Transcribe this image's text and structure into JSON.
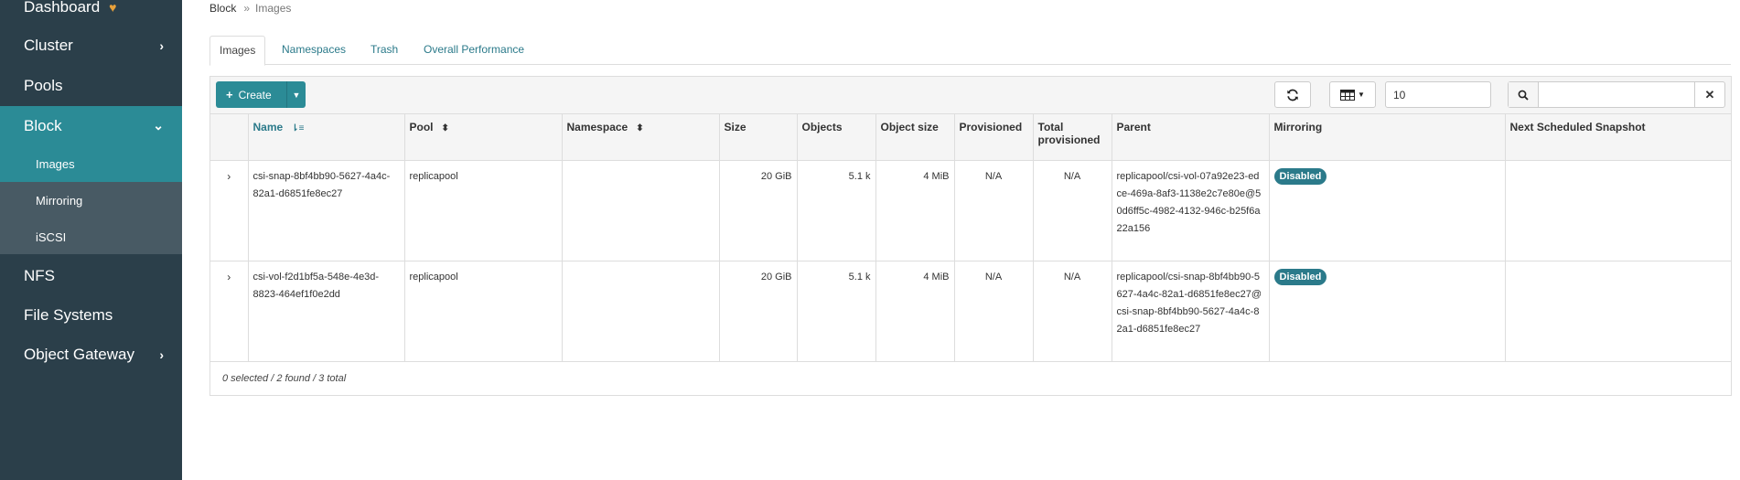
{
  "sidebar": {
    "dashboard": "Dashboard",
    "cluster": "Cluster",
    "pools": "Pools",
    "block": "Block",
    "block_sub": [
      "Images",
      "Mirroring",
      "iSCSI"
    ],
    "nfs": "NFS",
    "file_systems": "File Systems",
    "object_gateway": "Object Gateway"
  },
  "breadcrumb": {
    "parent": "Block",
    "separator": "»",
    "current": "Images"
  },
  "tabs": [
    "Images",
    "Namespaces",
    "Trash",
    "Overall Performance"
  ],
  "toolbar": {
    "create_label": "Create",
    "page_size": "10",
    "search_placeholder": ""
  },
  "table": {
    "columns": [
      "",
      "Name",
      "Pool",
      "Namespace",
      "Size",
      "Objects",
      "Object size",
      "Provisioned",
      "Total provisioned",
      "Parent",
      "Mirroring",
      "Next Scheduled Snapshot"
    ],
    "rows": [
      {
        "name": "csi-snap-8bf4bb90-5627-4a4c-82a1-d6851fe8ec27",
        "pool": "replicapool",
        "namespace": "",
        "size": "20 GiB",
        "objects": "5.1 k",
        "object_size": "4 MiB",
        "provisioned": "N/A",
        "total_provisioned": "N/A",
        "parent": "replicapool/csi-vol-07a92e23-edce-469a-8af3-1138e2c7e80e@50d6ff5c-4982-4132-946c-b25f6a22a156",
        "mirroring": "Disabled",
        "next_snapshot": ""
      },
      {
        "name": "csi-vol-f2d1bf5a-548e-4e3d-8823-464ef1f0e2dd",
        "pool": "replicapool",
        "namespace": "",
        "size": "20 GiB",
        "objects": "5.1 k",
        "object_size": "4 MiB",
        "provisioned": "N/A",
        "total_provisioned": "N/A",
        "parent": "replicapool/csi-snap-8bf4bb90-5627-4a4c-82a1-d6851fe8ec27@csi-snap-8bf4bb90-5627-4a4c-82a1-d6851fe8ec27",
        "mirroring": "Disabled",
        "next_snapshot": ""
      }
    ]
  },
  "footer": {
    "summary": "0 selected / 2 found / 3 total"
  },
  "colors": {
    "sidebar_bg": "#2b3f4a",
    "accent": "#2b8b96",
    "submenu_bg": "#485a64",
    "link": "#2b7a8a"
  }
}
